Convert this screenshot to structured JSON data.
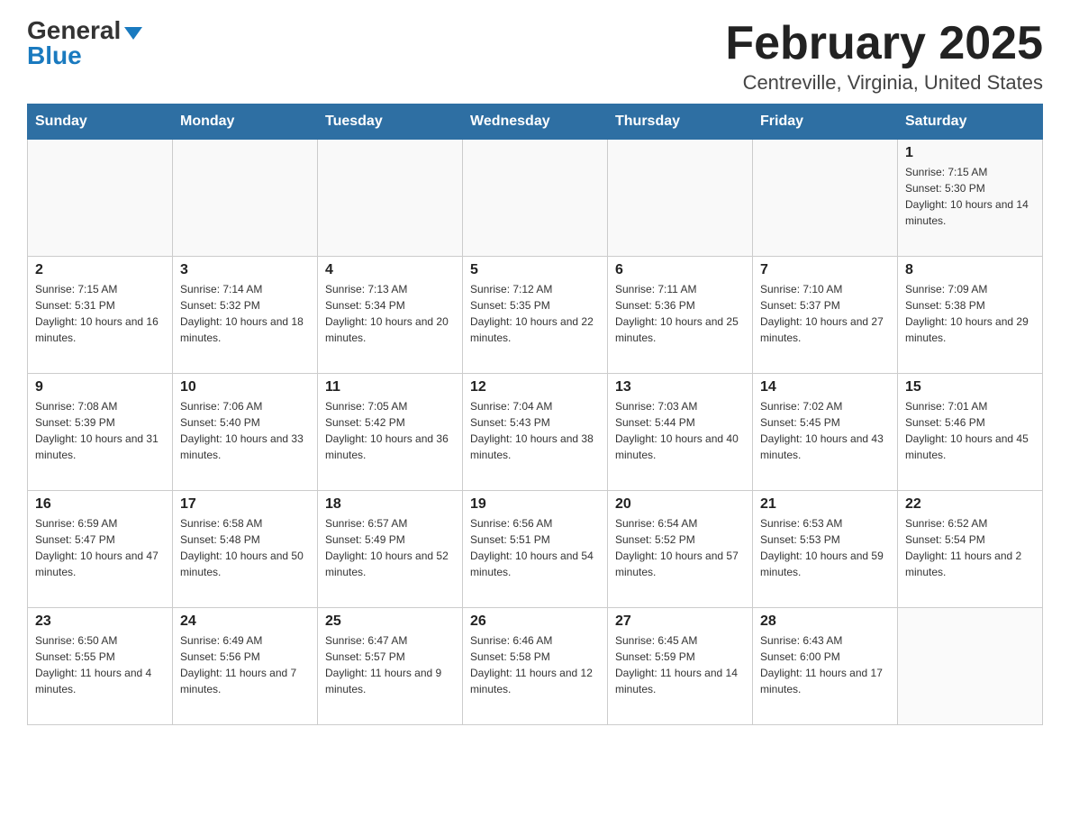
{
  "logo": {
    "general": "General",
    "blue": "Blue"
  },
  "title": "February 2025",
  "location": "Centreville, Virginia, United States",
  "weekdays": [
    "Sunday",
    "Monday",
    "Tuesday",
    "Wednesday",
    "Thursday",
    "Friday",
    "Saturday"
  ],
  "weeks": [
    [
      {
        "day": "",
        "info": ""
      },
      {
        "day": "",
        "info": ""
      },
      {
        "day": "",
        "info": ""
      },
      {
        "day": "",
        "info": ""
      },
      {
        "day": "",
        "info": ""
      },
      {
        "day": "",
        "info": ""
      },
      {
        "day": "1",
        "info": "Sunrise: 7:15 AM\nSunset: 5:30 PM\nDaylight: 10 hours and 14 minutes."
      }
    ],
    [
      {
        "day": "2",
        "info": "Sunrise: 7:15 AM\nSunset: 5:31 PM\nDaylight: 10 hours and 16 minutes."
      },
      {
        "day": "3",
        "info": "Sunrise: 7:14 AM\nSunset: 5:32 PM\nDaylight: 10 hours and 18 minutes."
      },
      {
        "day": "4",
        "info": "Sunrise: 7:13 AM\nSunset: 5:34 PM\nDaylight: 10 hours and 20 minutes."
      },
      {
        "day": "5",
        "info": "Sunrise: 7:12 AM\nSunset: 5:35 PM\nDaylight: 10 hours and 22 minutes."
      },
      {
        "day": "6",
        "info": "Sunrise: 7:11 AM\nSunset: 5:36 PM\nDaylight: 10 hours and 25 minutes."
      },
      {
        "day": "7",
        "info": "Sunrise: 7:10 AM\nSunset: 5:37 PM\nDaylight: 10 hours and 27 minutes."
      },
      {
        "day": "8",
        "info": "Sunrise: 7:09 AM\nSunset: 5:38 PM\nDaylight: 10 hours and 29 minutes."
      }
    ],
    [
      {
        "day": "9",
        "info": "Sunrise: 7:08 AM\nSunset: 5:39 PM\nDaylight: 10 hours and 31 minutes."
      },
      {
        "day": "10",
        "info": "Sunrise: 7:06 AM\nSunset: 5:40 PM\nDaylight: 10 hours and 33 minutes."
      },
      {
        "day": "11",
        "info": "Sunrise: 7:05 AM\nSunset: 5:42 PM\nDaylight: 10 hours and 36 minutes."
      },
      {
        "day": "12",
        "info": "Sunrise: 7:04 AM\nSunset: 5:43 PM\nDaylight: 10 hours and 38 minutes."
      },
      {
        "day": "13",
        "info": "Sunrise: 7:03 AM\nSunset: 5:44 PM\nDaylight: 10 hours and 40 minutes."
      },
      {
        "day": "14",
        "info": "Sunrise: 7:02 AM\nSunset: 5:45 PM\nDaylight: 10 hours and 43 minutes."
      },
      {
        "day": "15",
        "info": "Sunrise: 7:01 AM\nSunset: 5:46 PM\nDaylight: 10 hours and 45 minutes."
      }
    ],
    [
      {
        "day": "16",
        "info": "Sunrise: 6:59 AM\nSunset: 5:47 PM\nDaylight: 10 hours and 47 minutes."
      },
      {
        "day": "17",
        "info": "Sunrise: 6:58 AM\nSunset: 5:48 PM\nDaylight: 10 hours and 50 minutes."
      },
      {
        "day": "18",
        "info": "Sunrise: 6:57 AM\nSunset: 5:49 PM\nDaylight: 10 hours and 52 minutes."
      },
      {
        "day": "19",
        "info": "Sunrise: 6:56 AM\nSunset: 5:51 PM\nDaylight: 10 hours and 54 minutes."
      },
      {
        "day": "20",
        "info": "Sunrise: 6:54 AM\nSunset: 5:52 PM\nDaylight: 10 hours and 57 minutes."
      },
      {
        "day": "21",
        "info": "Sunrise: 6:53 AM\nSunset: 5:53 PM\nDaylight: 10 hours and 59 minutes."
      },
      {
        "day": "22",
        "info": "Sunrise: 6:52 AM\nSunset: 5:54 PM\nDaylight: 11 hours and 2 minutes."
      }
    ],
    [
      {
        "day": "23",
        "info": "Sunrise: 6:50 AM\nSunset: 5:55 PM\nDaylight: 11 hours and 4 minutes."
      },
      {
        "day": "24",
        "info": "Sunrise: 6:49 AM\nSunset: 5:56 PM\nDaylight: 11 hours and 7 minutes."
      },
      {
        "day": "25",
        "info": "Sunrise: 6:47 AM\nSunset: 5:57 PM\nDaylight: 11 hours and 9 minutes."
      },
      {
        "day": "26",
        "info": "Sunrise: 6:46 AM\nSunset: 5:58 PM\nDaylight: 11 hours and 12 minutes."
      },
      {
        "day": "27",
        "info": "Sunrise: 6:45 AM\nSunset: 5:59 PM\nDaylight: 11 hours and 14 minutes."
      },
      {
        "day": "28",
        "info": "Sunrise: 6:43 AM\nSunset: 6:00 PM\nDaylight: 11 hours and 17 minutes."
      },
      {
        "day": "",
        "info": ""
      }
    ]
  ]
}
